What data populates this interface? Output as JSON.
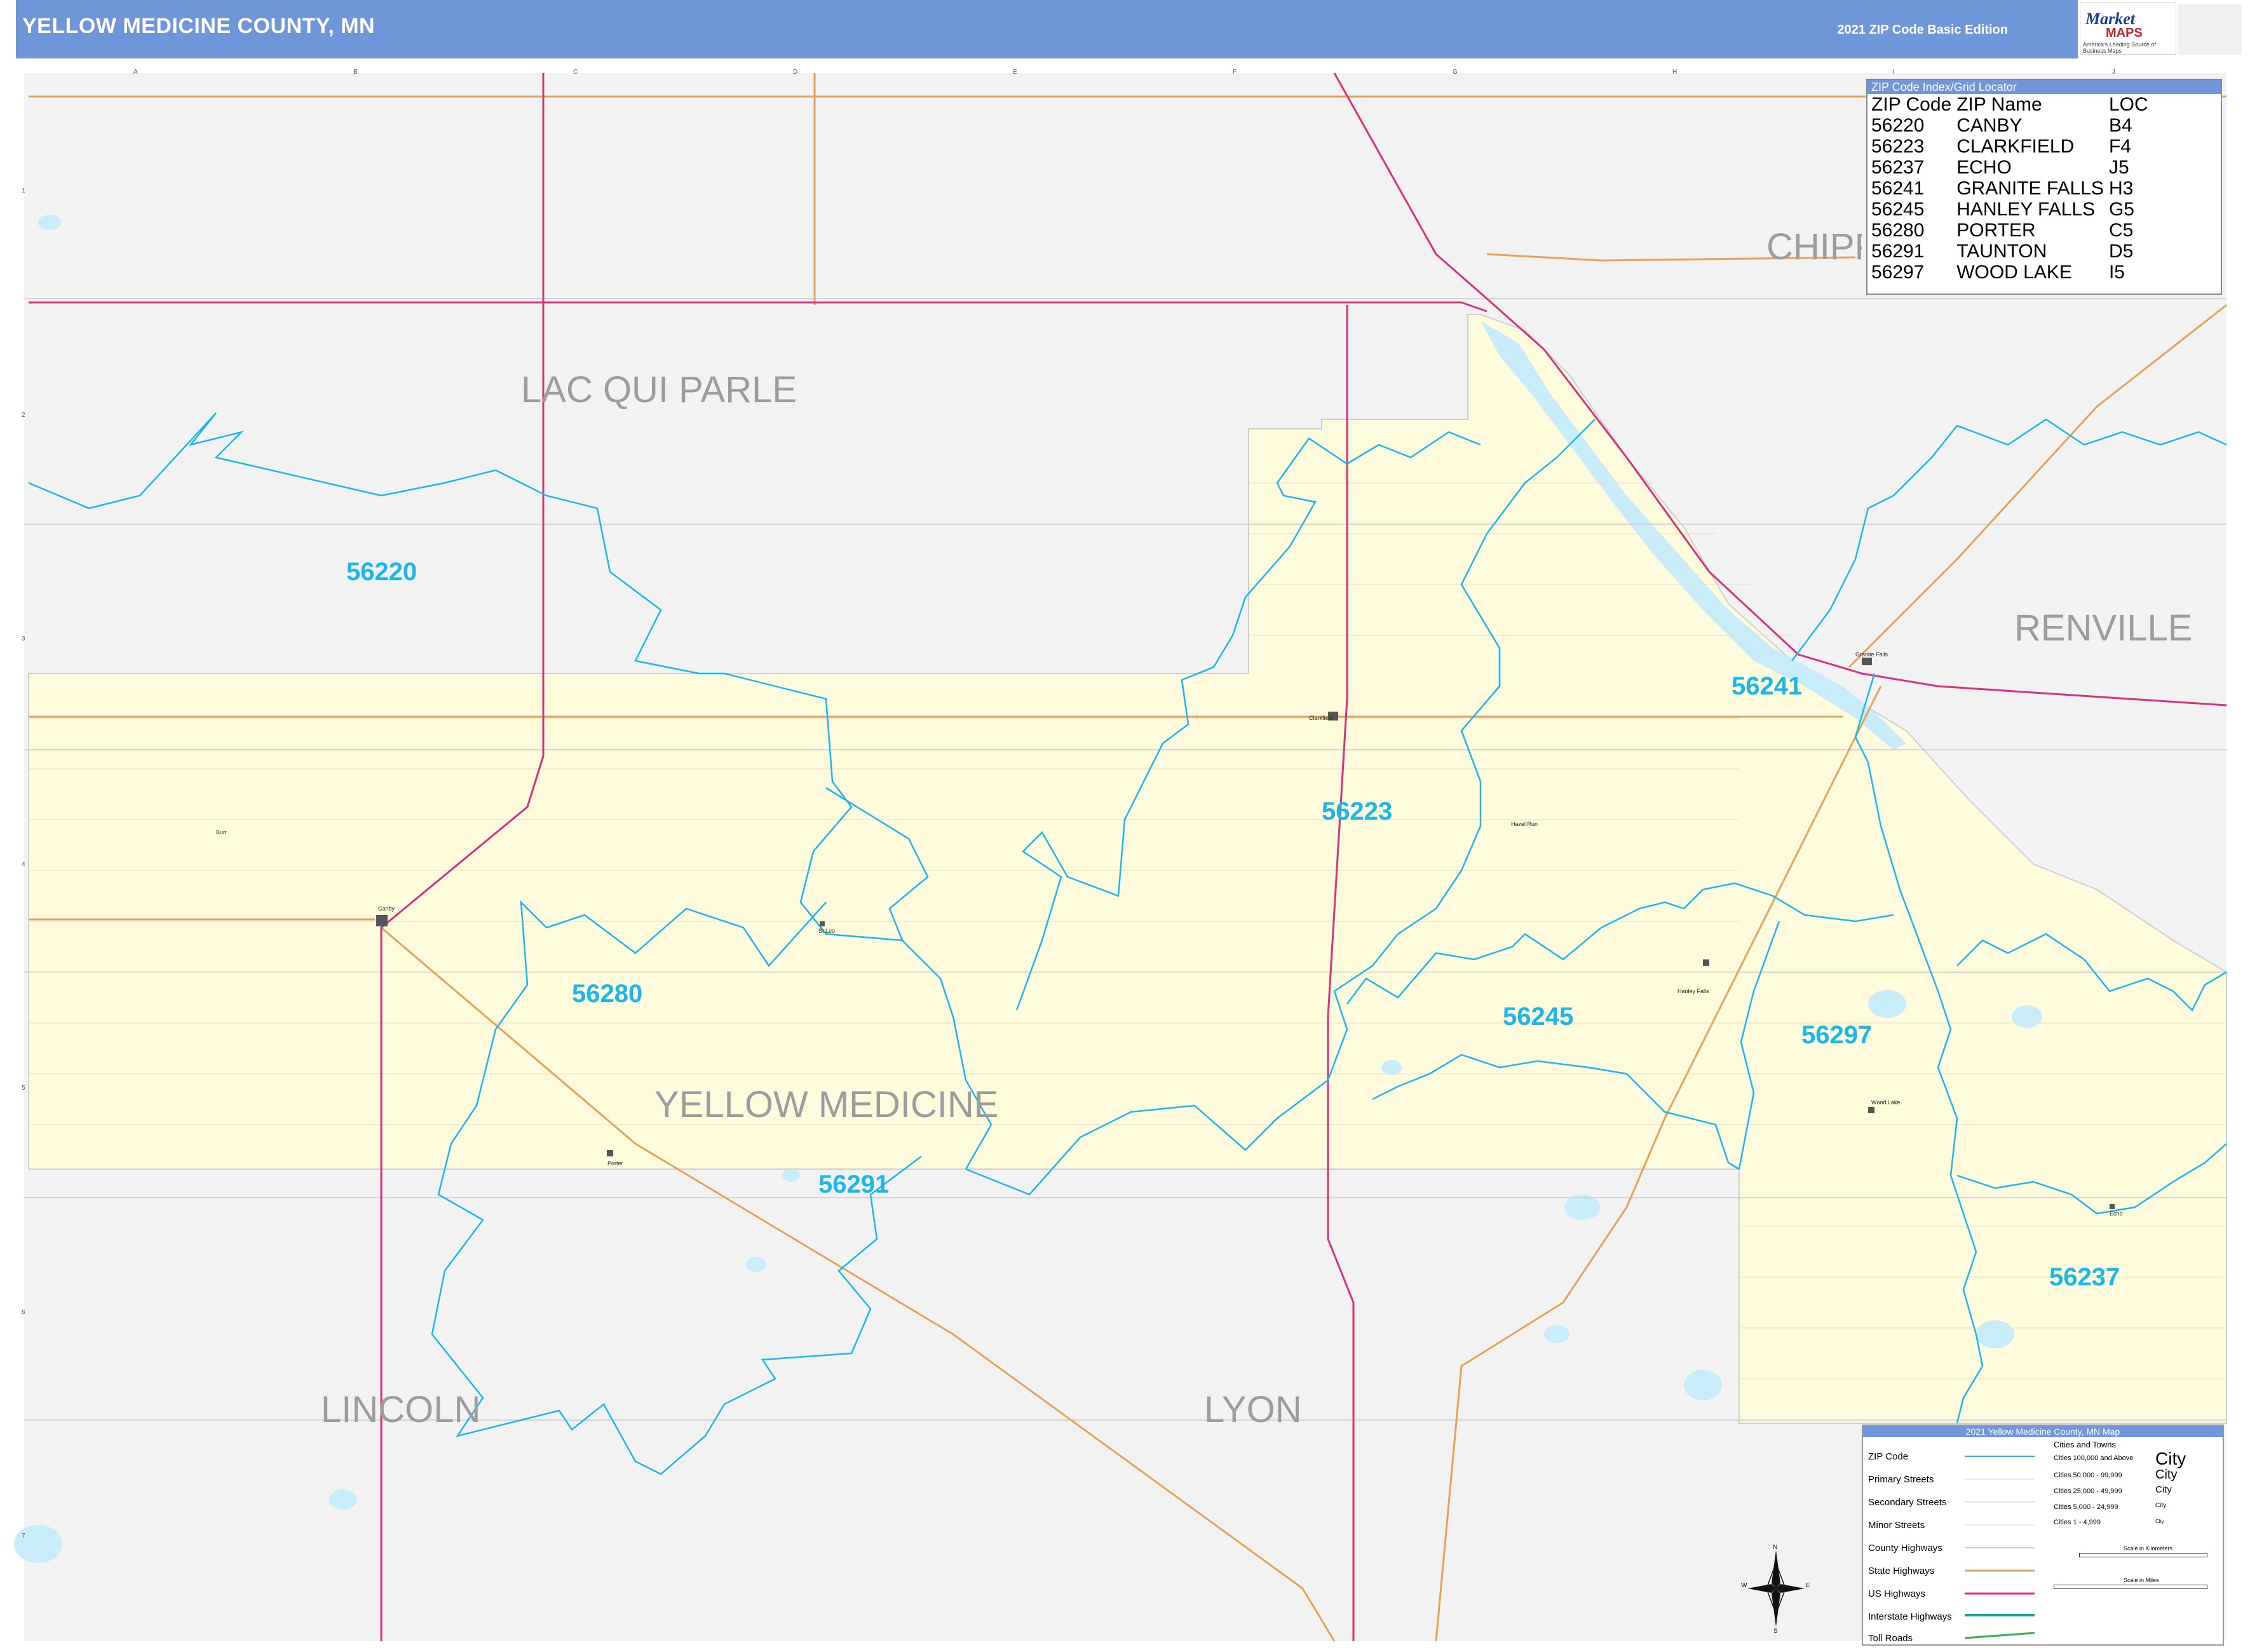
{
  "header": {
    "title": "YELLOW MEDICINE COUNTY, MN",
    "edition": "2021 ZIP Code Basic Edition"
  },
  "logo": {
    "brand": "Market",
    "sub": "MAPS",
    "tagline": "America's Leading Source of Business Maps"
  },
  "grid": {
    "columns": [
      "A",
      "B",
      "C",
      "D",
      "E",
      "F",
      "G",
      "H",
      "I",
      "J"
    ],
    "rows": [
      "1",
      "2",
      "3",
      "4",
      "5",
      "6",
      "7"
    ]
  },
  "counties": {
    "lac_qui_parle": "LAC QUI PARLE",
    "chippewa": "CHIPPEWA",
    "renville": "RENVILLE",
    "yellow_medicine": "YELLOW MEDICINE",
    "lincoln": "LINCOLN",
    "lyon": "LYON"
  },
  "zip_labels": [
    "56220",
    "56241",
    "56223",
    "56280",
    "56245",
    "56297",
    "56291",
    "56237"
  ],
  "towns": [
    "Canby",
    "Clarkfield",
    "Hanley Falls",
    "Wood Lake",
    "Porter",
    "St Leo",
    "Echo",
    "Granite Falls",
    "Burr",
    "Hazel Run"
  ],
  "index": {
    "header": "ZIP Code Index/Grid Locator",
    "columns": [
      "ZIP Code",
      "ZIP Name",
      "LOC"
    ],
    "rows": [
      [
        "56220",
        "CANBY",
        "B4"
      ],
      [
        "56223",
        "CLARKFIELD",
        "F4"
      ],
      [
        "56237",
        "ECHO",
        "J5"
      ],
      [
        "56241",
        "GRANITE FALLS",
        "H3"
      ],
      [
        "56245",
        "HANLEY FALLS",
        "G5"
      ],
      [
        "56280",
        "PORTER",
        "C5"
      ],
      [
        "56291",
        "TAUNTON",
        "D5"
      ],
      [
        "56297",
        "WOOD LAKE",
        "I5"
      ]
    ]
  },
  "legend": {
    "title": "2021 Yellow Medicine County, MN Map",
    "items": [
      "ZIP Code",
      "Primary Streets",
      "Secondary Streets",
      "Minor Streets",
      "County Highways",
      "State Highways",
      "US Highways",
      "Interstate Highways",
      "Toll Roads"
    ],
    "cities_header": "Cities and Towns",
    "cities": [
      "Cities 100,000 and Above",
      "Cities 50,000 - 99,999",
      "Cities 25,000 - 49,999",
      "Cities 5,000 - 24,999",
      "Cities 1 - 4,999"
    ],
    "city_samples": [
      "City",
      "City",
      "City",
      "City",
      "City"
    ],
    "scale_km": "Scale in Kilometers",
    "scale_mi": "Scale in Miles"
  },
  "compass": {
    "n": "N",
    "s": "S",
    "e": "E",
    "w": "W"
  },
  "colors": {
    "header": "#6f96d8",
    "county_fill": "#fdfbdc",
    "outside_fill": "#f2f2f2",
    "zip_boundary": "#1bb6ea",
    "us_highway": "#d6337f",
    "state_highway": "#e3a35a",
    "water": "#c8ecfa"
  }
}
